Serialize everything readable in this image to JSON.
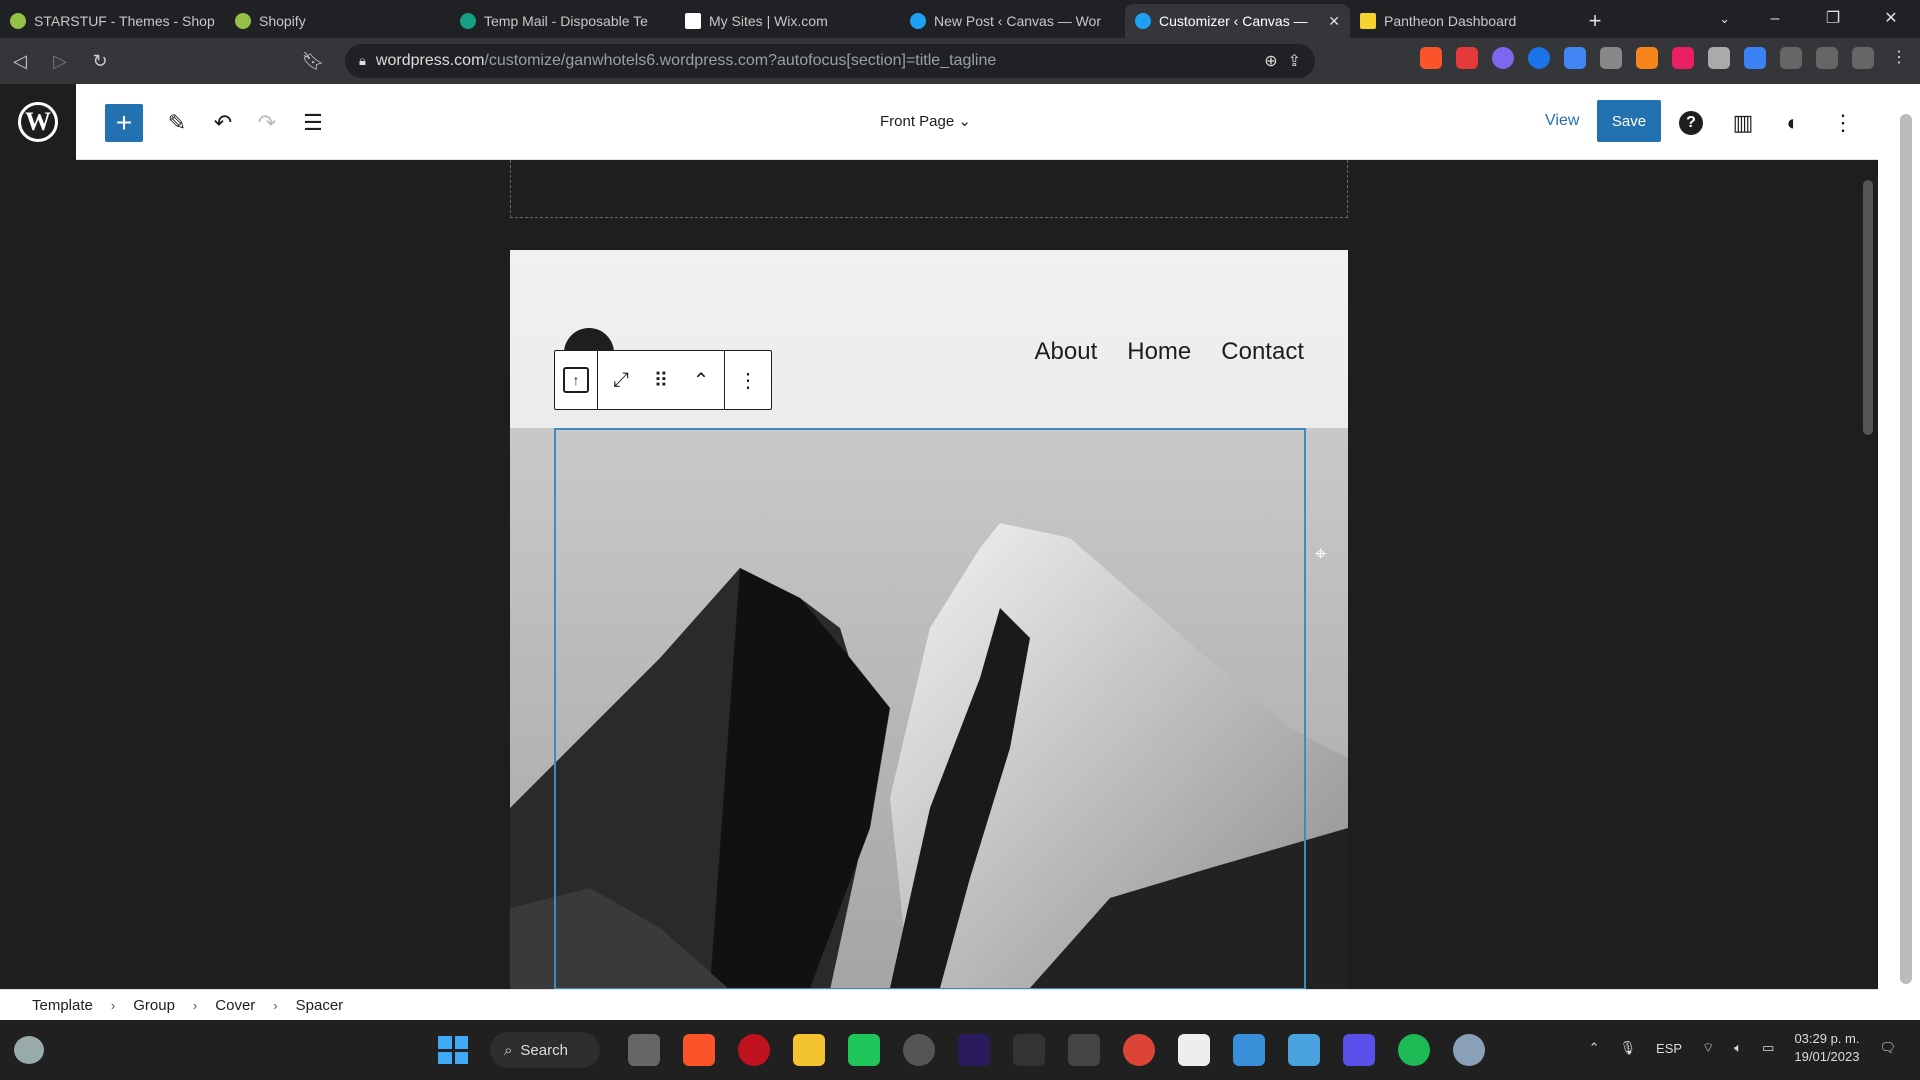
{
  "browser": {
    "tabs": [
      {
        "title": "STARSTUF - Themes - Shop",
        "color": "#95bf47"
      },
      {
        "title": "Shopify",
        "color": "#95bf47"
      },
      {
        "title": "Temp Mail - Disposable Te",
        "color": "#16a085"
      },
      {
        "title": "My Sites | Wix.com",
        "color": "#ffffff"
      },
      {
        "title": "New Post ‹ Canvas — Wor",
        "color": "#1da1f2"
      },
      {
        "title": "Customizer ‹ Canvas —",
        "color": "#1da1f2",
        "active": true
      },
      {
        "title": "Pantheon Dashboard",
        "color": "#f7d12e"
      }
    ],
    "url_host": "wordpress.com",
    "url_path": "/customize/ganwhotels6.wordpress.com?autofocus[section]=title_tagline"
  },
  "editor": {
    "document_title": "Front Page",
    "view_label": "View",
    "save_label": "Save",
    "help_label": "?"
  },
  "site": {
    "nav": [
      "About",
      "Home",
      "Contact"
    ]
  },
  "breadcrumb": [
    "Template",
    "Group",
    "Cover",
    "Spacer"
  ],
  "taskbar": {
    "search_label": "Search",
    "language": "ESP",
    "time": "03:29 p. m.",
    "date": "19/01/2023"
  },
  "colors": {
    "accent": "#2271b1",
    "selection": "#3b8dbd",
    "canvas_bg": "#1e1e1e"
  }
}
